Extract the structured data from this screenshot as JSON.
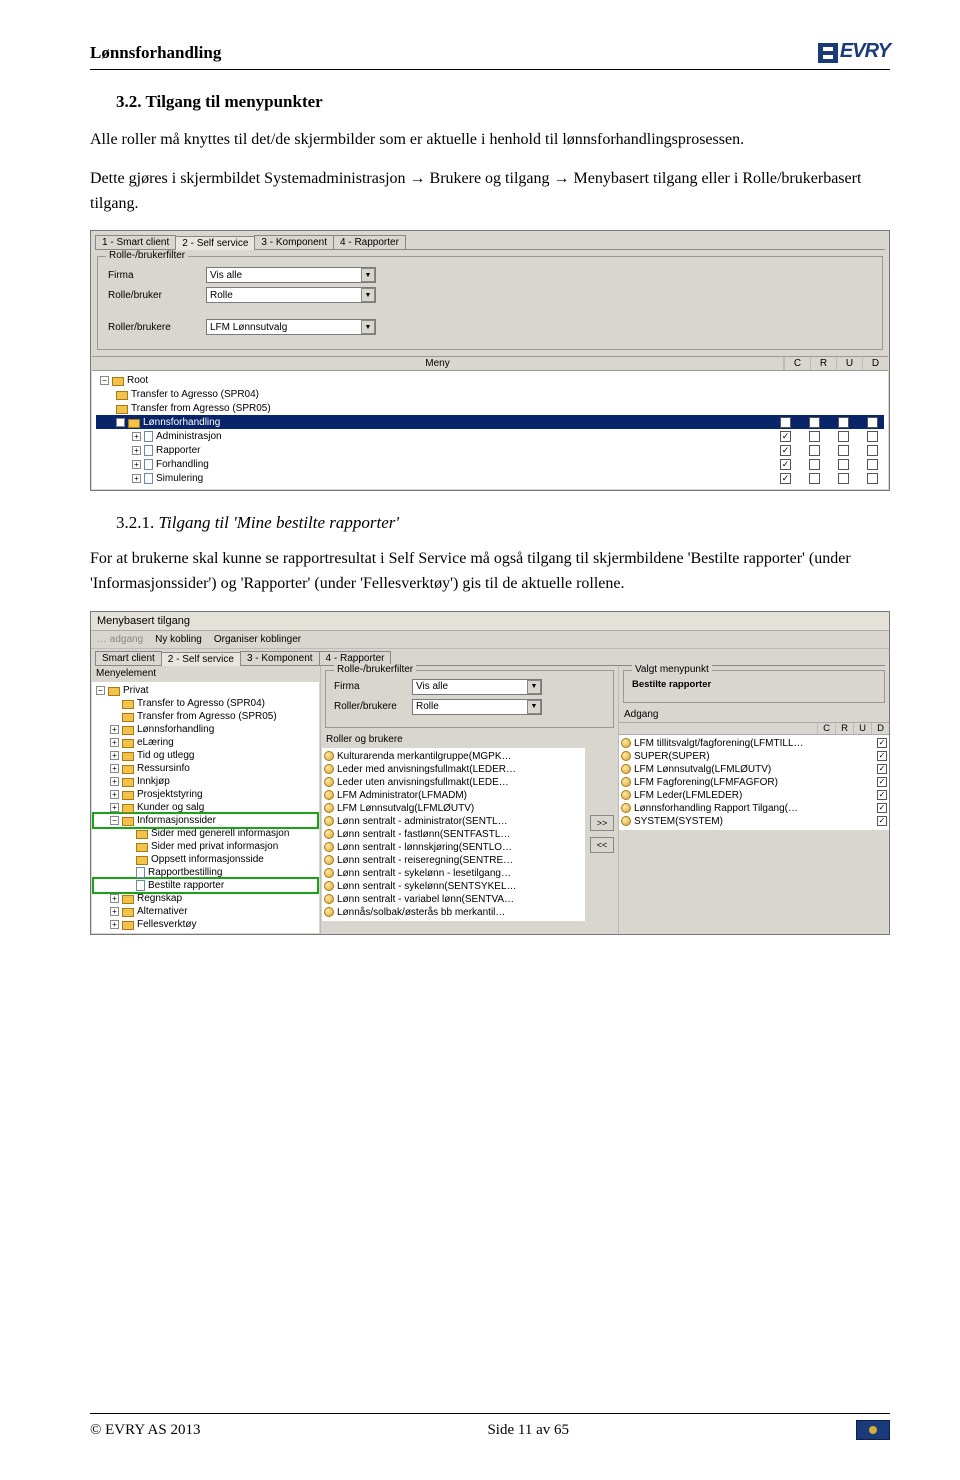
{
  "header": {
    "title": "Lønnsforhandling",
    "logo_text": "EVRY"
  },
  "section": {
    "heading": "3.2. Tilgang til menypunkter",
    "p1": "Alle roller må knyttes til det/de skjermbilder som er aktuelle i henhold til lønnsforhandlingsprosessen.",
    "p2a": "Dette gjøres i skjermbildet Systemadministrasjon ",
    "p2b": " Brukere og tilgang ",
    "p2c": " Menybasert tilgang eller i Rolle/brukerbasert tilgang.",
    "sub_heading_num": "3.2.1.",
    "sub_heading_txt": " Tilgang til 'Mine bestilte rapporter'",
    "p3": "For at brukerne skal kunne se rapportresultat i Self Service må også tilgang til skjermbildene 'Bestilte rapporter' (under 'Informasjonssider') og 'Rapporter' (under 'Fellesverktøy') gis til de aktuelle rollene."
  },
  "ss1": {
    "tabs": [
      "1 - Smart client",
      "2 - Self service",
      "3 - Komponent",
      "4 - Rapporter"
    ],
    "group_legend": "Rolle-/brukerfilter",
    "firma_lbl": "Firma",
    "firma_val": "Vis alle",
    "rb_lbl": "Rolle/bruker",
    "rb_val": "Rolle",
    "rbs_lbl": "Roller/brukere",
    "rbs_val": "LFM Lønnsutvalg",
    "grid_meny": "Meny",
    "cols": [
      "C",
      "R",
      "U",
      "D"
    ],
    "tree": [
      {
        "indent": 0,
        "exp": "−",
        "icon": "folder",
        "label": "Root",
        "sel": false,
        "checks": []
      },
      {
        "indent": 1,
        "exp": "",
        "icon": "folder",
        "label": "Transfer to Agresso (SPR04)",
        "sel": false,
        "checks": []
      },
      {
        "indent": 1,
        "exp": "",
        "icon": "folder",
        "label": "Transfer from Agresso (SPR05)",
        "sel": false,
        "checks": []
      },
      {
        "indent": 1,
        "exp": "−",
        "icon": "folder",
        "label": "Lønnsforhandling",
        "sel": true,
        "checks": [
          "✓",
          "",
          "",
          ""
        ]
      },
      {
        "indent": 2,
        "exp": "+",
        "icon": "page",
        "label": "Administrasjon",
        "sel": false,
        "checks": [
          "✓",
          "",
          "",
          ""
        ]
      },
      {
        "indent": 2,
        "exp": "+",
        "icon": "page",
        "label": "Rapporter",
        "sel": false,
        "checks": [
          "✓",
          "",
          "",
          ""
        ]
      },
      {
        "indent": 2,
        "exp": "+",
        "icon": "page",
        "label": "Forhandling",
        "sel": false,
        "checks": [
          "✓",
          "",
          "",
          ""
        ]
      },
      {
        "indent": 2,
        "exp": "+",
        "icon": "page",
        "label": "Simulering",
        "sel": false,
        "checks": [
          "✓",
          "",
          "",
          ""
        ]
      }
    ]
  },
  "ss2": {
    "title": "Menybasert tilgang",
    "toolbar": [
      "Ny kobling",
      "Organiser koblinger"
    ],
    "tabs": [
      "Smart client",
      "2 - Self service",
      "3 - Komponent",
      "4 - Rapporter"
    ],
    "left_lbl": "Menyelement",
    "left_tree": [
      {
        "indent": 0,
        "exp": "−",
        "icon": "folder",
        "label": "Privat",
        "green": false
      },
      {
        "indent": 1,
        "exp": "",
        "icon": "folder",
        "label": "Transfer to Agresso (SPR04)",
        "green": false
      },
      {
        "indent": 1,
        "exp": "",
        "icon": "folder",
        "label": "Transfer from Agresso (SPR05)",
        "green": false
      },
      {
        "indent": 1,
        "exp": "+",
        "icon": "folder",
        "label": "Lønnsforhandling",
        "green": false
      },
      {
        "indent": 1,
        "exp": "+",
        "icon": "folder",
        "label": "eLæring",
        "green": false
      },
      {
        "indent": 1,
        "exp": "+",
        "icon": "folder",
        "label": "Tid og utlegg",
        "green": false
      },
      {
        "indent": 1,
        "exp": "+",
        "icon": "folder",
        "label": "Ressursinfo",
        "green": false
      },
      {
        "indent": 1,
        "exp": "+",
        "icon": "folder",
        "label": "Innkjøp",
        "green": false
      },
      {
        "indent": 1,
        "exp": "+",
        "icon": "folder",
        "label": "Prosjektstyring",
        "green": false
      },
      {
        "indent": 1,
        "exp": "+",
        "icon": "folder",
        "label": "Kunder og salg",
        "green": false
      },
      {
        "indent": 1,
        "exp": "−",
        "icon": "folder",
        "label": "Informasjonssider",
        "green": true
      },
      {
        "indent": 2,
        "exp": "",
        "icon": "folder",
        "label": "Sider med generell informasjon",
        "green": false
      },
      {
        "indent": 2,
        "exp": "",
        "icon": "folder",
        "label": "Sider med privat informasjon",
        "green": false
      },
      {
        "indent": 2,
        "exp": "",
        "icon": "folder",
        "label": "Oppsett informasjonsside",
        "green": false
      },
      {
        "indent": 2,
        "exp": "",
        "icon": "page",
        "label": "Rapportbestilling",
        "green": false
      },
      {
        "indent": 2,
        "exp": "",
        "icon": "page",
        "label": "Bestilte rapporter",
        "green": true
      },
      {
        "indent": 1,
        "exp": "+",
        "icon": "folder",
        "label": "Regnskap",
        "green": false
      },
      {
        "indent": 1,
        "exp": "+",
        "icon": "folder",
        "label": "Alternativer",
        "green": false
      },
      {
        "indent": 1,
        "exp": "+",
        "icon": "folder",
        "label": "Fellesverktøy",
        "green": false
      }
    ],
    "mid_group": "Rolle-/brukerfilter",
    "mid_firma_lbl": "Firma",
    "mid_firma_val": "Vis alle",
    "mid_rb_lbl": "Roller/brukere",
    "mid_rb_val": "Rolle",
    "mid_list_lbl": "Roller og brukere",
    "mid_list": [
      "Kulturarenda merkantilgruppe(MGPK…",
      "Leder med anvisningsfullmakt(LEDER…",
      "Leder uten anvisningsfullmakt(LEDE…",
      "LFM Administrator(LFMADM)",
      "LFM Lønnsutvalg(LFMLØUTV)",
      "Lønn sentralt - administrator(SENTL…",
      "Lønn sentralt - fastlønn(SENTFASTL…",
      "Lønn sentralt - lønnskjøring(SENTLO…",
      "Lønn sentralt - reiseregning(SENTRE…",
      "Lønn sentralt - sykelønn - lesetilgang…",
      "Lønn sentralt - sykelønn(SENTSYKEL…",
      "Lønn sentralt - variabel lønn(SENTVA…",
      "Lønnås/solbak/østerås bb merkantil…"
    ],
    "mover": [
      ">>",
      "<<"
    ],
    "right_group": "Valgt menypunkt",
    "right_val": "Bestilte rapporter",
    "adgang_lbl": "Adgang",
    "adgang_cols": [
      "C",
      "R",
      "U",
      "D"
    ],
    "adgang_list": [
      {
        "label": "LFM tillitsvalgt/fagforening(LFMTILL…",
        "c": "✓"
      },
      {
        "label": "SUPER(SUPER)",
        "c": "✓"
      },
      {
        "label": "LFM Lønnsutvalg(LFMLØUTV)",
        "c": "✓"
      },
      {
        "label": "LFM Fagforening(LFMFAGFOR)",
        "c": "✓"
      },
      {
        "label": "LFM Leder(LFMLEDER)",
        "c": "✓"
      },
      {
        "label": "Lønnsforhandling Rapport Tilgang(…",
        "c": "✓"
      },
      {
        "label": "SYSTEM(SYSTEM)",
        "c": "✓"
      }
    ]
  },
  "footer": {
    "left": "© EVRY AS 2013",
    "right": "Side 11 av 65"
  }
}
